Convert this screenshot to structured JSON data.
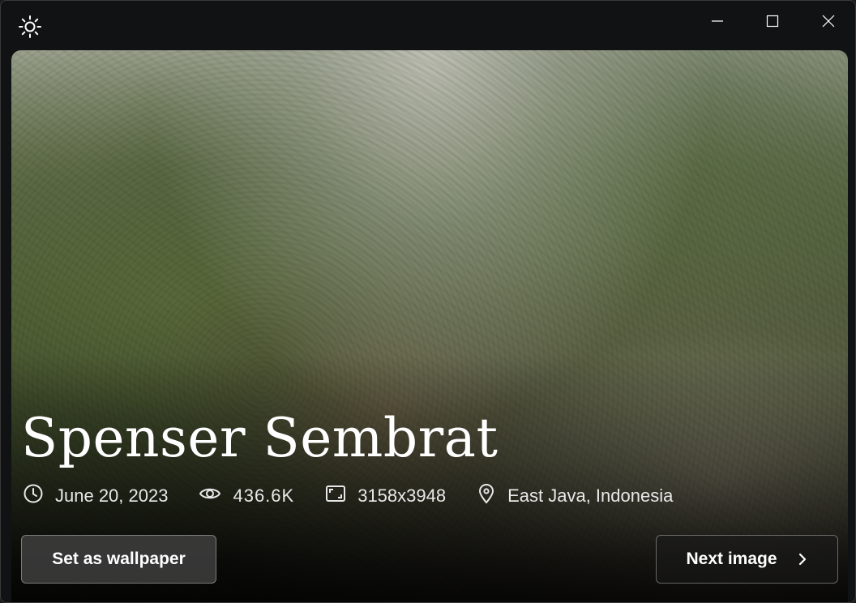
{
  "window": {
    "app_icon": "sun-icon",
    "controls": {
      "minimize": "minimize-icon",
      "maximize": "maximize-icon",
      "close": "close-icon"
    }
  },
  "photo": {
    "author": "Spenser Sembrat",
    "date": "June 20, 2023",
    "views": "436.6K",
    "resolution": "3158x3948",
    "location": "East Java, Indonesia",
    "icons": {
      "date": "clock-icon",
      "views": "eye-icon",
      "resolution": "aspect-ratio-icon",
      "location": "location-pin-icon"
    }
  },
  "actions": {
    "set_wallpaper_label": "Set as wallpaper",
    "next_image_label": "Next image",
    "next_icon": "chevron-right-icon"
  },
  "colors": {
    "window_bg": "#111214",
    "text": "#ffffff",
    "meta_text": "#e8e8e8"
  }
}
